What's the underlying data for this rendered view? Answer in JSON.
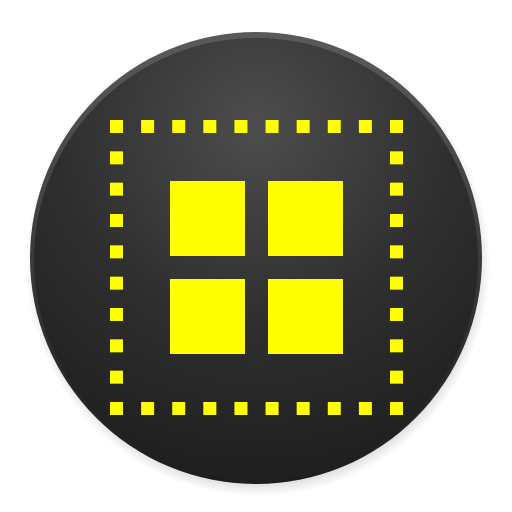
{
  "icon": {
    "name": "grid-selection-app-icon",
    "description_colors": {
      "background_dark": "#262626",
      "background_light": "#4a4a4a",
      "accent": "#ffff00"
    },
    "grid_tiles": 4
  }
}
